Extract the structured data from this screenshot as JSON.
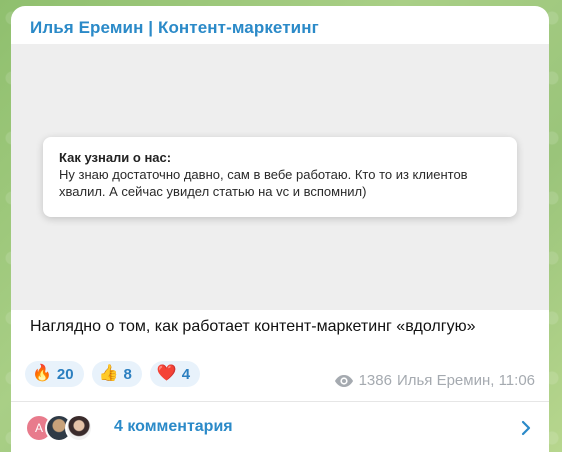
{
  "post": {
    "channel_name": "Илья Еремин | Контент-маркетинг",
    "card": {
      "title": "Как узнали о нас:",
      "line1": "Ну знаю достаточно давно, сам в вебе работаю. Кто то из клиентов",
      "line2": "хвалил. А сейчас увидел статью на vc и вспомнил)"
    },
    "caption": "Наглядно о том, как работает контент-маркетинг «вдолгую»",
    "reactions": [
      {
        "emoji": "🔥",
        "count": "20"
      },
      {
        "emoji": "👍",
        "count": "8"
      },
      {
        "emoji": "❤️",
        "count": "4"
      }
    ],
    "views": "1386",
    "author_time": "Илья Еремин, 11:06",
    "comments": {
      "avatar_letter": "А",
      "label": "4 комментария"
    }
  },
  "colors": {
    "accent": "#2b8ac8",
    "reaction_bg": "#e8f2fb",
    "meta": "#a5aab0"
  },
  "icons": [
    "eye-icon",
    "chevron-right-icon"
  ]
}
